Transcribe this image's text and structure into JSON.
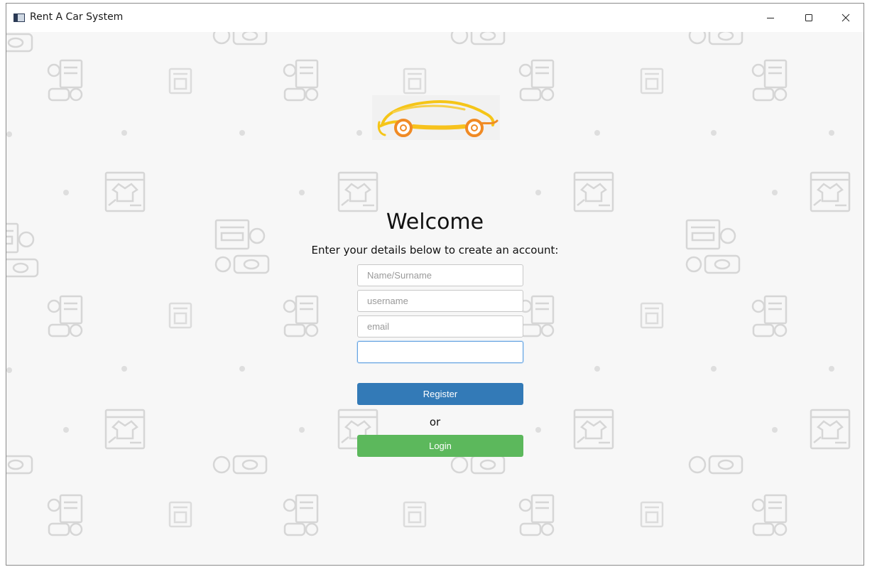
{
  "window": {
    "title": "Rent A Car System"
  },
  "form": {
    "heading": "Welcome",
    "subtitle": "Enter your details below to create an account:",
    "fields": [
      {
        "placeholder": "Name/Surname",
        "value": ""
      },
      {
        "placeholder": "username",
        "value": ""
      },
      {
        "placeholder": "email",
        "value": ""
      },
      {
        "placeholder": "",
        "value": ""
      }
    ],
    "register_label": "Register",
    "or_label": "or",
    "login_label": "Login"
  },
  "colors": {
    "register": "#337ab7",
    "login": "#5cb85c",
    "logo_yellow": "#f5c518",
    "logo_orange": "#f08a24"
  },
  "icons": {
    "app": "app-window-icon",
    "minimize": "minimize-icon",
    "maximize": "maximize-icon",
    "close": "close-icon",
    "logo": "car-logo-icon"
  }
}
